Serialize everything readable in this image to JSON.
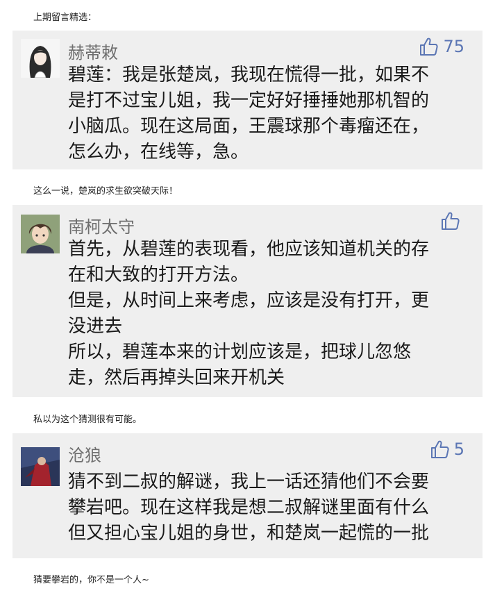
{
  "captions": [
    "上期留言精选：",
    "这么一说，楚岚的求生欲突破天际！",
    "私以为这个猜测很有可能。",
    "猜要攀岩的，你不是一个人~"
  ],
  "comments": [
    {
      "username": "赫蒂敕",
      "likes": "75",
      "lines": [
        "碧莲：我是张楚岚，我现在慌得一批，如果不",
        "是打不过宝儿姐，我一定好好捶捶她那机智的",
        "小脑瓜。现在这局面，王震球那个毒瘤还在，",
        "怎么办，在线等，急。"
      ]
    },
    {
      "username": "南柯太守",
      "likes": "",
      "lines": [
        "首先，从碧莲的表现看，他应该知道机关的存",
        "在和大致的打开方法。",
        "但是，从时间上来考虑，应该是没有打开，更",
        "没进去",
        "所以，碧莲本来的计划应该是，把球儿忽悠",
        "走，然后再掉头回来开机关"
      ]
    },
    {
      "username": "沧狼",
      "likes": "5",
      "lines": [
        "猜不到二叔的解谜，我上一话还猜他们不会要",
        "攀岩吧。现在这样我是想二叔解谜里面有什么",
        "但又担心宝儿姐的身世，和楚岚一起慌的一批"
      ]
    }
  ],
  "colors": {
    "card_bg": "#efefef",
    "username": "#6f6f6f",
    "like": "#5b76b4"
  }
}
